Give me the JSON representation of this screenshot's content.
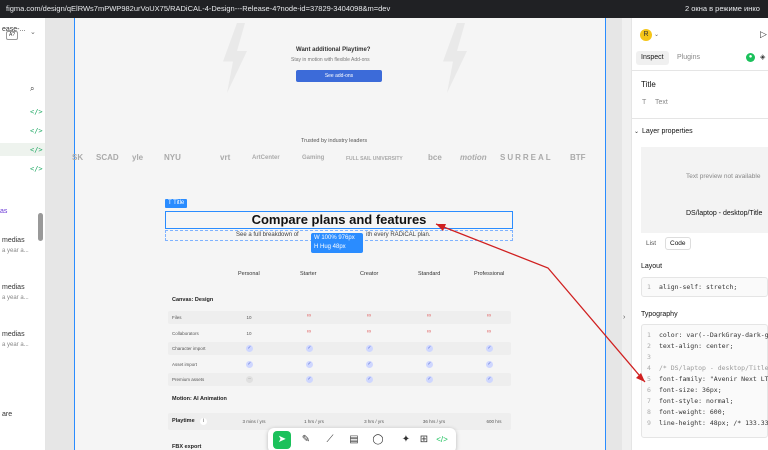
{
  "browser": {
    "url": "figma.com/design/qElRWs7mPWP982urVoUX75/RADiCAL-4-Design---Release-4?node-id=37829-3404098&m=dev",
    "incognito_label": "2 окна в режиме инко"
  },
  "left_panel": {
    "file_fragment": "ease-...",
    "items": [
      {
        "label": "as",
        "sub": ""
      },
      {
        "label": "medias",
        "sub": "a year a..."
      },
      {
        "label": "medias",
        "sub": "a year a..."
      },
      {
        "label": "medias",
        "sub": "a year a..."
      },
      {
        "label": "are",
        "sub": ""
      }
    ]
  },
  "canvas": {
    "upsell_title": "Want additional Playtime?",
    "upsell_sub": "Stay in motion with flexible Add-ons",
    "upsell_button": "See add-ons",
    "trusted": "Trusted by industry leaders",
    "logos": [
      "SK",
      "SCAD",
      "yle",
      "NYU",
      "vrt",
      "ArtCenter",
      "Gaming",
      "FULL SAIL UNIVERSITY",
      "bce",
      "motion",
      "SURREAL",
      "BTF"
    ],
    "title_tag": "Title",
    "title": "Compare plans and features",
    "subtitle_a": "See a full breakdown of",
    "subtitle_b": "ith every RADiCAL plan.",
    "dim_w": "W 100%  976px",
    "dim_h": "H Hug      48px",
    "columns": [
      "Personal",
      "Starter",
      "Creator",
      "Standard",
      "Professional"
    ],
    "section1": "Canvas: Design",
    "rows1": [
      {
        "label": "Files",
        "cells": [
          "10",
          "∞",
          "∞",
          "∞",
          "∞"
        ]
      },
      {
        "label": "Collaborators",
        "cells": [
          "10",
          "∞",
          "∞",
          "∞",
          "∞"
        ]
      },
      {
        "label": "Character import",
        "cells": [
          "✓",
          "✓",
          "✓",
          "✓",
          "✓"
        ]
      },
      {
        "label": "Asset import",
        "cells": [
          "✓",
          "✓",
          "✓",
          "✓",
          "✓"
        ]
      },
      {
        "label": "Premium assets",
        "cells": [
          "–",
          "✓",
          "✓",
          "✓",
          "✓"
        ]
      }
    ],
    "section2": "Motion: AI Animation",
    "rows2": [
      {
        "label": "Playtime",
        "cells": [
          "3 mins / yrs",
          "1 hrs / yrs",
          "3 hrs / yrs",
          "36 hrs / yrs",
          "600 hrs"
        ]
      },
      {
        "label": "FBX export",
        "cells": [
          "",
          "",
          "",
          "",
          ""
        ]
      }
    ]
  },
  "right_panel": {
    "avatar": "R",
    "tabs": [
      "Inspect",
      "Plugins"
    ],
    "node_title": "Title",
    "node_type": "Text",
    "layer_props": "Layer properties",
    "preview_text": "Text preview not available",
    "preview_path": "DS/laptop - desktop/Title",
    "view_tabs": [
      "List",
      "Code"
    ],
    "layout_label": "Layout",
    "layout_code": [
      {
        "n": "1",
        "t": "align-self: stretch;"
      }
    ],
    "typography_label": "Typography",
    "typo_code": [
      {
        "n": "1",
        "t": "color: var(--DarkGray-dark-g"
      },
      {
        "n": "2",
        "t": "text-align: center;"
      },
      {
        "n": "3",
        "t": ""
      },
      {
        "n": "4",
        "t": "/* DS/laptop - desktop/Title"
      },
      {
        "n": "5",
        "t": "font-family: \"Avenir Next LT"
      },
      {
        "n": "6",
        "t": "font-size: 36px;"
      },
      {
        "n": "7",
        "t": "font-style: normal;"
      },
      {
        "n": "8",
        "t": "font-weight: 600;"
      },
      {
        "n": "9",
        "t": "line-height: 48px; /* 133.33"
      }
    ]
  },
  "colors": {
    "accent": "#2a8cff",
    "brand_green": "#1bc15b",
    "arrow": "#d02020"
  }
}
